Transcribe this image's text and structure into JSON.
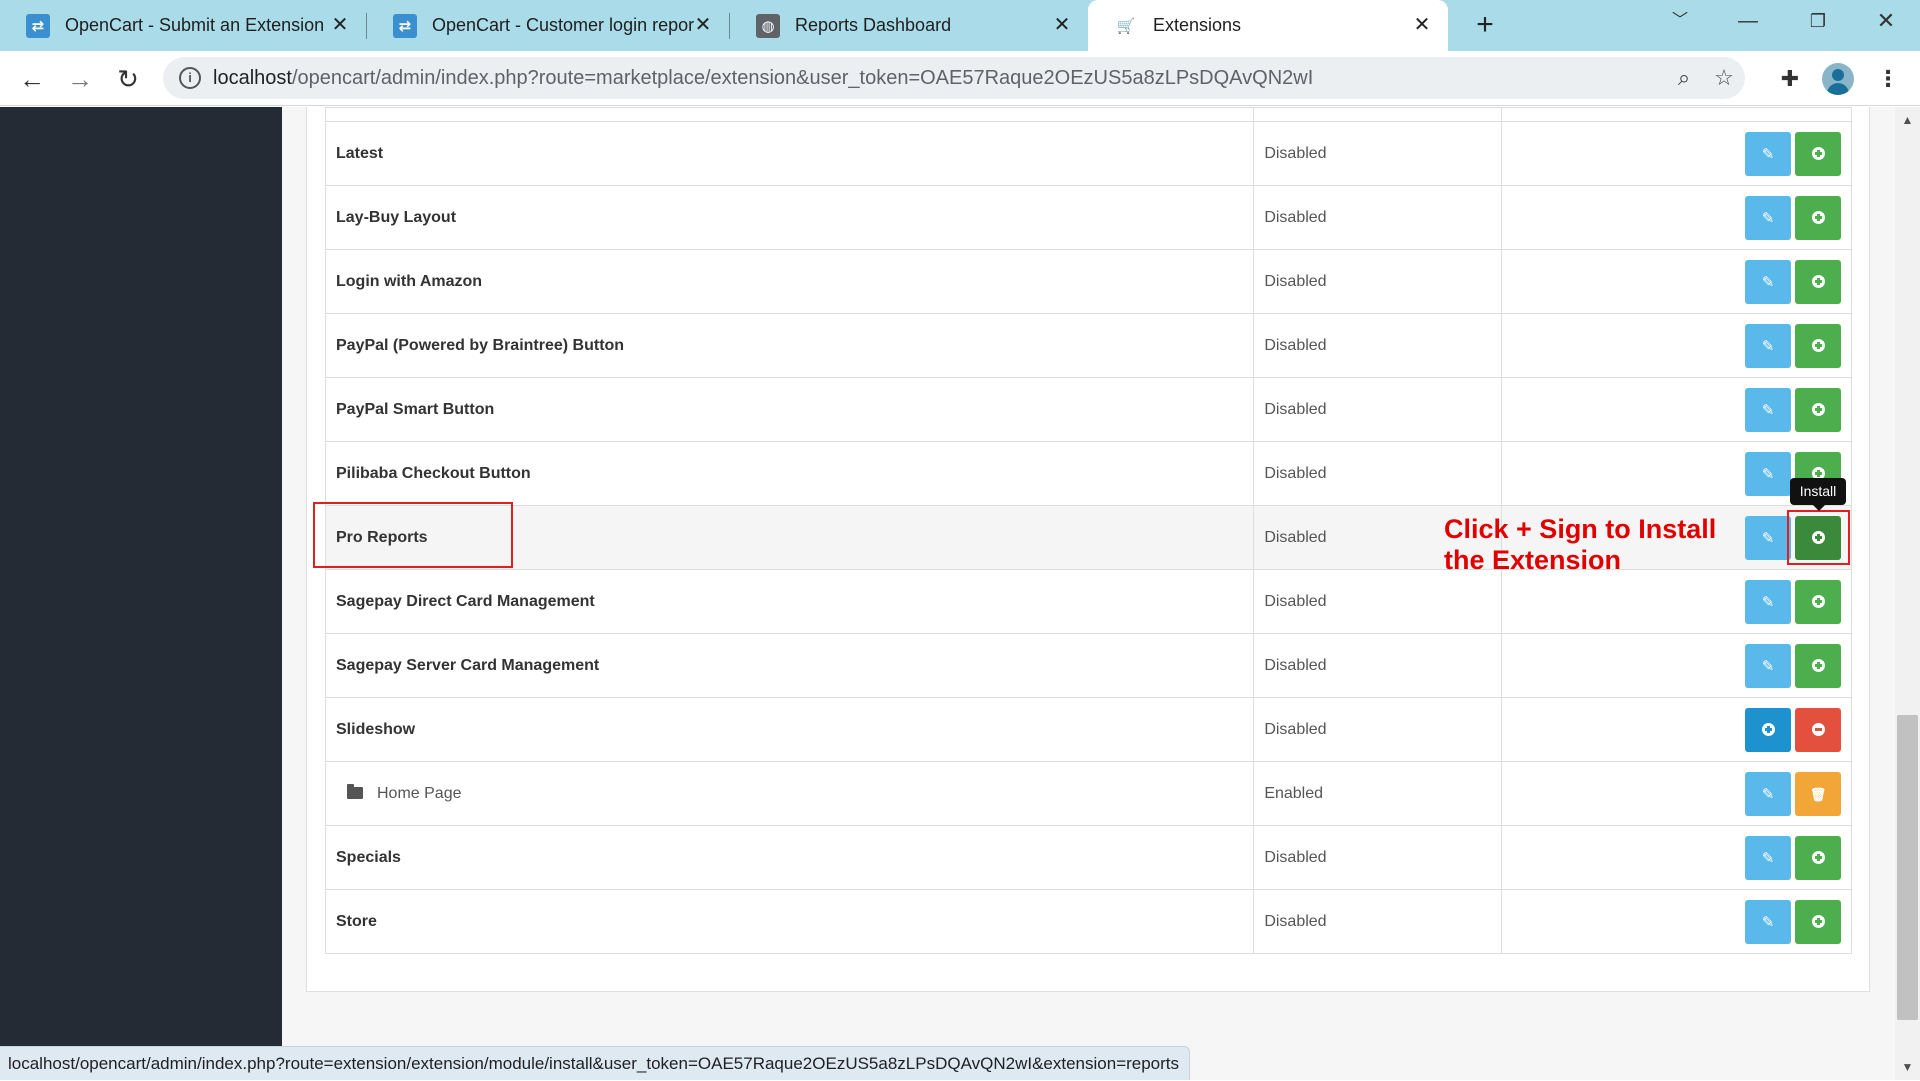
{
  "browser": {
    "tabs": [
      {
        "title": "OpenCart - Submit an Extension",
        "favicon": "opencart-icon"
      },
      {
        "title": "OpenCart - Customer login repor",
        "favicon": "opencart-icon"
      },
      {
        "title": "Reports Dashboard",
        "favicon": "globe-icon"
      },
      {
        "title": "Extensions",
        "favicon": "cart-icon",
        "active": true
      }
    ],
    "url_host": "localhost",
    "url_path": "/opencart/admin/index.php?route=marketplace/extension&user_token=OAE57Raque2OEzUS5a8zLPsDQAvQN2wI"
  },
  "extensions": {
    "rows": [
      {
        "name": "Latest",
        "status": "Disabled",
        "actions": [
          "edit",
          "install"
        ]
      },
      {
        "name": "Lay-Buy Layout",
        "status": "Disabled",
        "actions": [
          "edit",
          "install"
        ]
      },
      {
        "name": "Login with Amazon",
        "status": "Disabled",
        "actions": [
          "edit",
          "install"
        ]
      },
      {
        "name": "PayPal (Powered by Braintree) Button",
        "status": "Disabled",
        "actions": [
          "edit",
          "install"
        ]
      },
      {
        "name": "PayPal Smart Button",
        "status": "Disabled",
        "actions": [
          "edit",
          "install"
        ]
      },
      {
        "name": "Pilibaba Checkout Button",
        "status": "Disabled",
        "actions": [
          "edit",
          "install"
        ]
      },
      {
        "name": "Pro Reports",
        "status": "Disabled",
        "actions": [
          "edit",
          "install"
        ],
        "highlighted": true
      },
      {
        "name": "Sagepay Direct Card Management",
        "status": "Disabled",
        "actions": [
          "edit",
          "install"
        ]
      },
      {
        "name": "Sagepay Server Card Management",
        "status": "Disabled",
        "actions": [
          "edit",
          "install"
        ]
      },
      {
        "name": "Slideshow",
        "status": "Disabled",
        "actions": [
          "add",
          "uninstall"
        ]
      },
      {
        "name": "Home Page",
        "status": "Enabled",
        "actions": [
          "edit",
          "delete"
        ],
        "child": true
      },
      {
        "name": "Specials",
        "status": "Disabled",
        "actions": [
          "edit",
          "install"
        ]
      },
      {
        "name": "Store",
        "status": "Disabled",
        "actions": [
          "edit",
          "install"
        ]
      }
    ]
  },
  "tooltip": {
    "text": "Install"
  },
  "annotation": {
    "line1": "Click + Sign to Install",
    "line2": "the Extension",
    "color": "#e10000"
  },
  "status_url": "localhost/opencart/admin/index.php?route=extension/extension/module/install&user_token=OAE57Raque2OEzUS5a8zLPsDQAvQN2wI&extension=reports",
  "colors": {
    "edit": "#5bb8ea",
    "install": "#4cae4c",
    "add": "#1e91cf",
    "uninstall": "#e3503e",
    "delete": "#f3a638",
    "sidebar": "#252b34"
  }
}
